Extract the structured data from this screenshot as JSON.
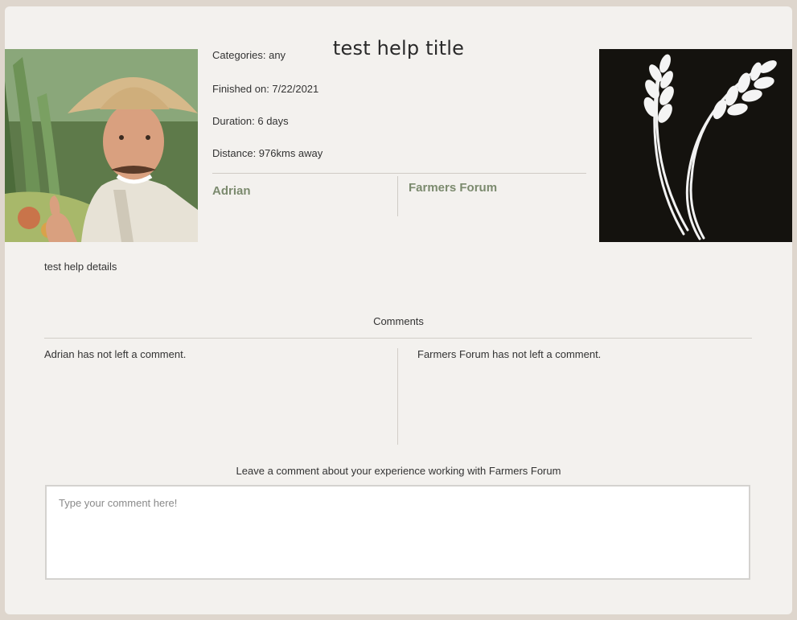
{
  "post": {
    "title": "test help title",
    "categories": "Categories: any",
    "finished_on": "Finished on: 7/22/2021",
    "duration": "Duration: 6 days",
    "distance": "Distance: 976kms away",
    "details": "test help details"
  },
  "parties": {
    "helper_name": "Adrian",
    "host_name": "Farmers Forum"
  },
  "comments": {
    "heading": "Comments",
    "helper_comment": "Adrian has not left a comment.",
    "host_comment": "Farmers Forum has not left a comment."
  },
  "new_comment": {
    "label": "Leave a comment about your experience working with Farmers Forum",
    "placeholder": "Type your comment here!"
  },
  "images": {
    "left": "person-in-straw-hat-photo",
    "right": "wheat-logo"
  },
  "colors": {
    "page_background": "#ded6cd",
    "card_background": "#f3f1ee",
    "link": "#7b8a6e"
  }
}
